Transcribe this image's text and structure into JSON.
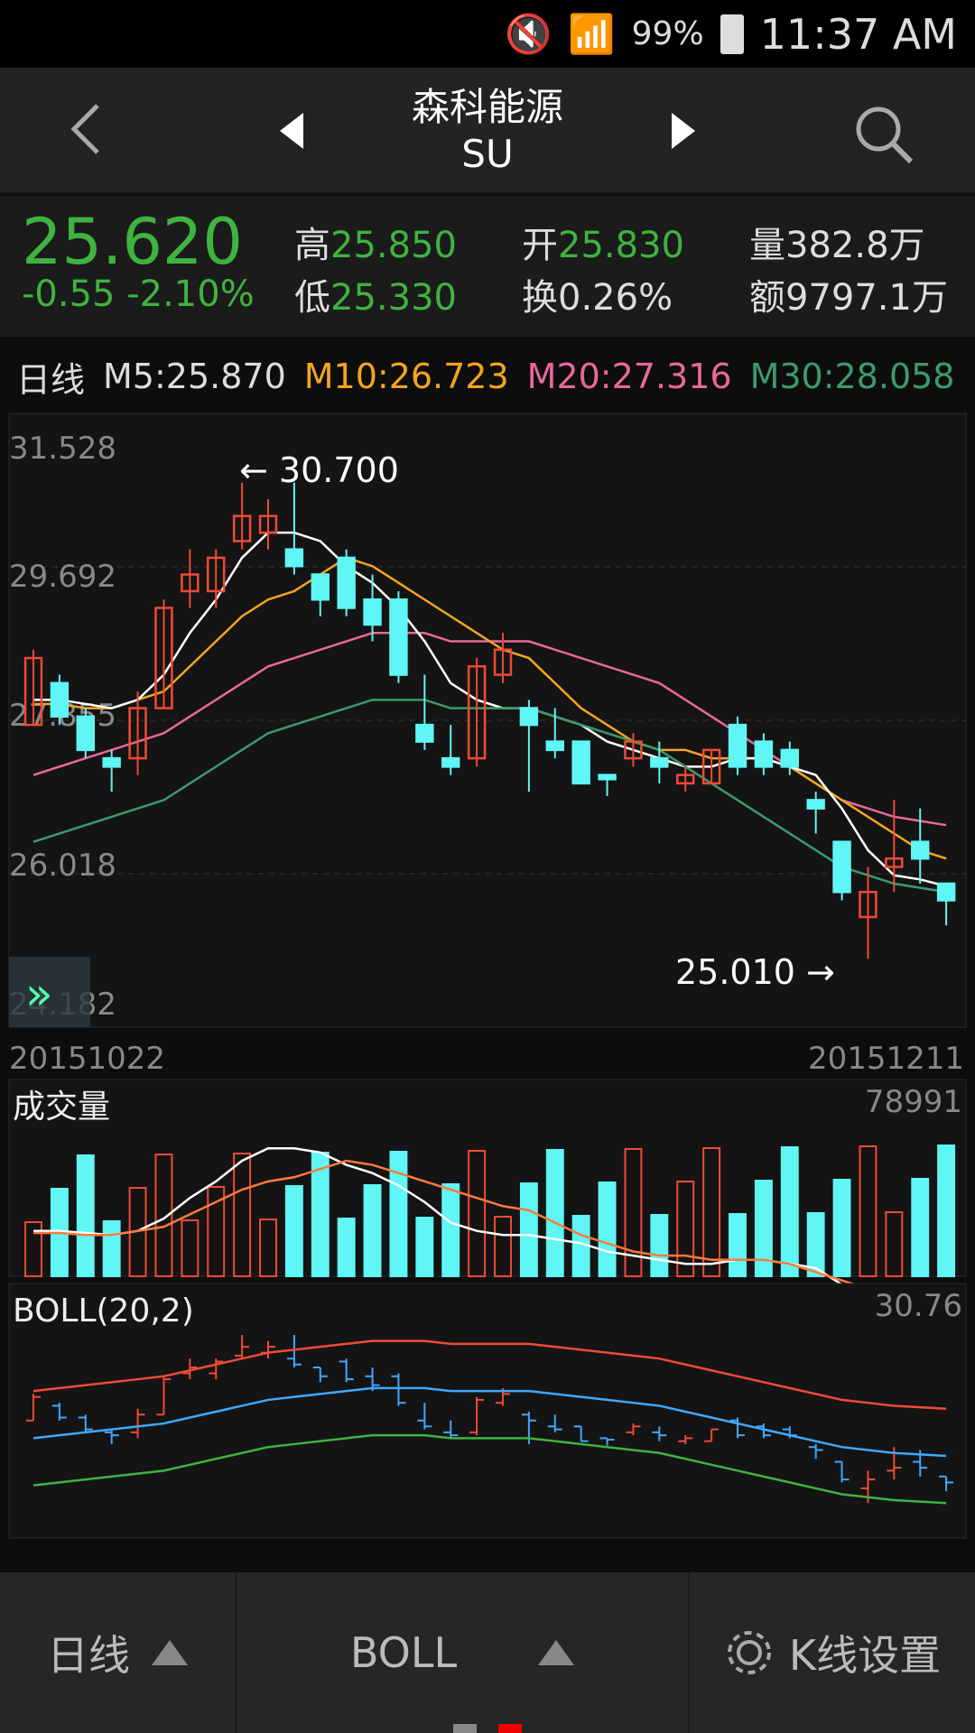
{
  "status_bar": {
    "battery": "99%",
    "time": "11:37 AM"
  },
  "header": {
    "name": "森科能源",
    "symbol": "SU"
  },
  "quote": {
    "price": "25.620",
    "change": "-0.55 -2.10%",
    "high_label": "高",
    "high": "25.850",
    "low_label": "低",
    "low": "25.330",
    "open_label": "开",
    "open": "25.830",
    "turnover_label": "换",
    "turnover": "0.26%",
    "volume_label": "量",
    "volume": "382.8万",
    "amount_label": "额",
    "amount": "9797.1万"
  },
  "ma_legend": {
    "period": "日线",
    "m5": "M5:25.870",
    "m10": "M10:26.723",
    "m20": "M20:27.316",
    "m30": "M30:28.058"
  },
  "colors": {
    "up": "#f04a35",
    "down": "#5ff6f5",
    "m5": "#ffffff",
    "m10": "#f3a51f",
    "m20": "#e8689a",
    "m30": "#3c9a6c",
    "green": "#3fb33f"
  },
  "price_chart": {
    "y_ticks": [
      "31.528",
      "29.692",
      "27.855",
      "26.018",
      "24.182"
    ],
    "max_label": "← 30.700",
    "min_label": "25.010 →",
    "start_date": "20151022",
    "end_date": "20151211"
  },
  "volume_panel": {
    "title": "成交量",
    "max": "78991"
  },
  "boll_panel": {
    "title": "BOLL(20,2)",
    "max": "30.76"
  },
  "bottom_bar": {
    "period": "日线",
    "indicator": "BOLL",
    "settings": "K线设置"
  },
  "chart_data": {
    "type": "candlestick",
    "ylim": [
      24.182,
      31.528
    ],
    "candles": [
      {
        "o": 27.8,
        "c": 28.6,
        "h": 28.7,
        "l": 27.8
      },
      {
        "o": 28.3,
        "c": 27.9,
        "h": 28.4,
        "l": 27.8
      },
      {
        "o": 27.9,
        "c": 27.5,
        "h": 28.0,
        "l": 27.4
      },
      {
        "o": 27.4,
        "c": 27.3,
        "h": 27.5,
        "l": 27.0
      },
      {
        "o": 27.4,
        "c": 28.0,
        "h": 28.2,
        "l": 27.2
      },
      {
        "o": 28.0,
        "c": 29.2,
        "h": 29.3,
        "l": 28.0
      },
      {
        "o": 29.4,
        "c": 29.6,
        "h": 29.9,
        "l": 29.2
      },
      {
        "o": 29.4,
        "c": 29.8,
        "h": 29.9,
        "l": 29.2
      },
      {
        "o": 30.0,
        "c": 30.3,
        "h": 30.7,
        "l": 29.9
      },
      {
        "o": 30.1,
        "c": 30.3,
        "h": 30.5,
        "l": 29.9
      },
      {
        "o": 29.9,
        "c": 29.7,
        "h": 30.7,
        "l": 29.6
      },
      {
        "o": 29.6,
        "c": 29.3,
        "h": 29.6,
        "l": 29.1
      },
      {
        "o": 29.8,
        "c": 29.2,
        "h": 29.9,
        "l": 29.1
      },
      {
        "o": 29.3,
        "c": 29.0,
        "h": 29.6,
        "l": 28.8
      },
      {
        "o": 29.3,
        "c": 28.4,
        "h": 29.4,
        "l": 28.3
      },
      {
        "o": 27.8,
        "c": 27.6,
        "h": 28.4,
        "l": 27.5
      },
      {
        "o": 27.4,
        "c": 27.3,
        "h": 27.8,
        "l": 27.2
      },
      {
        "o": 27.4,
        "c": 28.5,
        "h": 28.6,
        "l": 27.3
      },
      {
        "o": 28.4,
        "c": 28.7,
        "h": 28.9,
        "l": 28.3
      },
      {
        "o": 28.0,
        "c": 27.8,
        "h": 28.1,
        "l": 27.0
      },
      {
        "o": 27.6,
        "c": 27.5,
        "h": 28.0,
        "l": 27.4
      },
      {
        "o": 27.6,
        "c": 27.1,
        "h": 27.6,
        "l": 27.1
      },
      {
        "o": 27.2,
        "c": 27.15,
        "h": 27.2,
        "l": 26.95
      },
      {
        "o": 27.4,
        "c": 27.6,
        "h": 27.7,
        "l": 27.3
      },
      {
        "o": 27.4,
        "c": 27.3,
        "h": 27.6,
        "l": 27.1
      },
      {
        "o": 27.1,
        "c": 27.2,
        "h": 27.3,
        "l": 27.0
      },
      {
        "o": 27.1,
        "c": 27.5,
        "h": 27.5,
        "l": 27.1
      },
      {
        "o": 27.8,
        "c": 27.3,
        "h": 27.9,
        "l": 27.2
      },
      {
        "o": 27.6,
        "c": 27.3,
        "h": 27.7,
        "l": 27.2
      },
      {
        "o": 27.5,
        "c": 27.3,
        "h": 27.6,
        "l": 27.2
      },
      {
        "o": 26.9,
        "c": 26.8,
        "h": 27.0,
        "l": 26.5
      },
      {
        "o": 26.4,
        "c": 25.8,
        "h": 26.4,
        "l": 25.7
      },
      {
        "o": 25.5,
        "c": 25.8,
        "h": 26.1,
        "l": 25.0
      },
      {
        "o": 26.1,
        "c": 26.2,
        "h": 26.9,
        "l": 25.8
      },
      {
        "o": 26.4,
        "c": 26.2,
        "h": 26.8,
        "l": 25.9
      },
      {
        "o": 25.9,
        "c": 25.7,
        "h": 25.9,
        "l": 25.4
      }
    ],
    "m5": [
      28.1,
      28.1,
      28.05,
      28.0,
      28.1,
      28.4,
      28.9,
      29.3,
      29.8,
      30.1,
      30.1,
      30.0,
      29.7,
      29.5,
      29.2,
      28.8,
      28.3,
      28.1,
      28.0,
      28.0,
      27.9,
      27.8,
      27.6,
      27.5,
      27.4,
      27.3,
      27.3,
      27.4,
      27.4,
      27.3,
      27.2,
      26.8,
      26.3,
      26.0,
      25.95,
      25.87
    ],
    "m10": [
      28.05,
      28.05,
      28.0,
      28.0,
      28.1,
      28.2,
      28.5,
      28.8,
      29.1,
      29.3,
      29.4,
      29.6,
      29.8,
      29.7,
      29.5,
      29.3,
      29.1,
      28.9,
      28.7,
      28.6,
      28.3,
      28.0,
      27.8,
      27.6,
      27.5,
      27.5,
      27.4,
      27.4,
      27.4,
      27.3,
      27.1,
      26.9,
      26.7,
      26.5,
      26.3,
      26.2
    ],
    "m20": [
      27.2,
      27.3,
      27.4,
      27.5,
      27.6,
      27.7,
      27.9,
      28.1,
      28.3,
      28.5,
      28.6,
      28.7,
      28.8,
      28.9,
      28.9,
      28.9,
      28.8,
      28.8,
      28.8,
      28.8,
      28.7,
      28.6,
      28.5,
      28.4,
      28.3,
      28.1,
      27.9,
      27.7,
      27.5,
      27.3,
      27.1,
      26.9,
      26.8,
      26.7,
      26.65,
      26.6
    ]
  }
}
